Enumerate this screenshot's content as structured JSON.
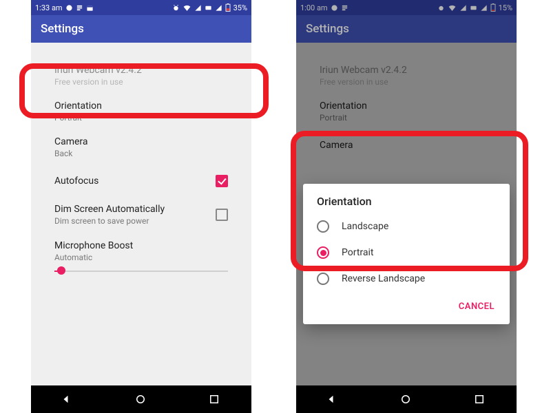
{
  "accent_pink": "#e91e63",
  "accent_blue": "#3f51b5",
  "highlight_red": "#ec1c24",
  "left": {
    "status": {
      "time": "1:33 am",
      "battery": "35%"
    },
    "appbar_title": "Settings",
    "header": {
      "app": "Iriun Webcam v2.4.2",
      "note": "Free version in use"
    },
    "orientation": {
      "label": "Orientation",
      "value": "Portrait"
    },
    "camera": {
      "label": "Camera",
      "value": "Back"
    },
    "autofocus": {
      "label": "Autofocus",
      "checked": true
    },
    "dim": {
      "label": "Dim Screen Automatically",
      "sub": "Dim screen to save power",
      "checked": false
    },
    "mic": {
      "label": "Microphone Boost",
      "value": "Automatic",
      "slider_pct": 4
    }
  },
  "right": {
    "status": {
      "time": "1:00 am",
      "battery": "15%"
    },
    "appbar_title": "Settings",
    "header": {
      "app": "Iriun Webcam v2.4.2",
      "note": "Free version in use"
    },
    "orientation": {
      "label": "Orientation",
      "value": "Portrait"
    },
    "camera": {
      "label": "Camera"
    },
    "dialog": {
      "title": "Orientation",
      "options": [
        "Landscape",
        "Portrait",
        "Reverse Landscape"
      ],
      "selected": "Portrait",
      "cancel": "CANCEL"
    }
  }
}
